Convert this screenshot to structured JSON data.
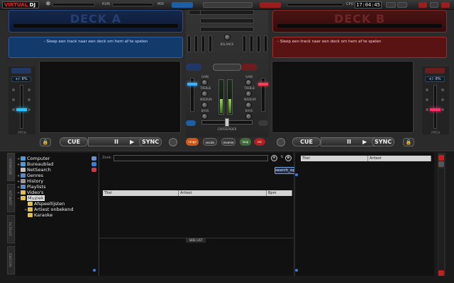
{
  "app": {
    "logo_part1": "VIRTUAL",
    "logo_part2": "DJ",
    "clock": "17:04:45"
  },
  "topbar": {
    "star_icon": "star-icon",
    "labels": [
      "RUN",
      "MIX",
      "CPU"
    ]
  },
  "decks": {
    "a": {
      "name": "DECK A",
      "message": "- Sleep een track naar een deck om hem af te spelen",
      "pitch_value": "+/- 8%",
      "pitch_label": "PITCH",
      "cue": "CUE",
      "play_pause": "II",
      "play": "▶",
      "sync": "SYNC",
      "accent": "#27c2ff"
    },
    "b": {
      "name": "DECK B",
      "message": "- Sleep een track naar een deck om hem af te spelen",
      "pitch_value": "+/- 8%",
      "pitch_label": "PITCH",
      "cue": "CUE",
      "play_pause": "II",
      "play": "▶",
      "sync": "SYNC",
      "accent": "#ff2f6a"
    }
  },
  "mixer": {
    "crossfader_label": "CROSSFADER",
    "balance_label": "BALANCE",
    "eq_labels": [
      "GAIN",
      "TREBLE",
      "MEDIUM",
      "BASS"
    ],
    "buttons": [
      "range",
      "vocals",
      "reverse",
      "loop",
      "rec"
    ]
  },
  "browser": {
    "sidetabs": [
      "BROWSER",
      "SAMPLER",
      "EFFECTS",
      "RECORD"
    ],
    "tree": [
      {
        "label": "Computer",
        "indent": 0,
        "twist": "+",
        "color": "#4a9ae0"
      },
      {
        "label": "Bureaublad",
        "indent": 0,
        "twist": "+",
        "color": "#4a9ae0"
      },
      {
        "label": "NetSearch",
        "indent": 0,
        "twist": "",
        "color": "#c0c0c0"
      },
      {
        "label": "Genres",
        "indent": 0,
        "twist": "+",
        "color": "#5c8ac9"
      },
      {
        "label": "History",
        "indent": 0,
        "twist": "+",
        "color": "#999999"
      },
      {
        "label": "Playlists",
        "indent": 0,
        "twist": "+",
        "color": "#5c8ac9"
      },
      {
        "label": "Video's",
        "indent": 0,
        "twist": "+",
        "color": "#e0c04a"
      },
      {
        "label": "Muziek",
        "indent": 0,
        "twist": "−",
        "color": "#e0c04a",
        "selected": true
      },
      {
        "label": "Afspeellijsten",
        "indent": 1,
        "twist": "",
        "color": "#e0c04a"
      },
      {
        "label": "Artiest onbekend",
        "indent": 1,
        "twist": "+",
        "color": "#e0c04a"
      },
      {
        "label": "Karaoke",
        "indent": 1,
        "twist": "",
        "color": "#e0c04a"
      }
    ],
    "search_label": "Zoek:",
    "search_value": "",
    "tooltip": "search_options",
    "columns": [
      "Titel",
      "Artiest",
      "Bpm"
    ],
    "side_list_label": "SIDE LIST",
    "right_columns": [
      "Titel",
      "Artiest"
    ]
  }
}
